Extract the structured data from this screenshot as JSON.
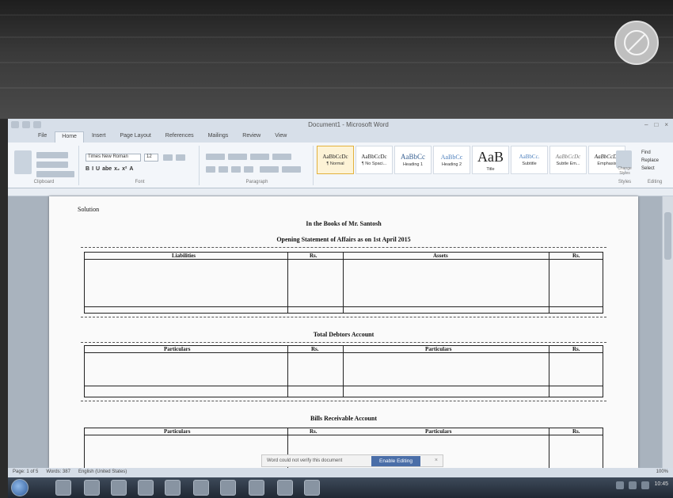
{
  "window": {
    "title": "Document1 - Microsoft Word",
    "controls": [
      "–",
      "□",
      "×"
    ]
  },
  "tabs": [
    "File",
    "Home",
    "Insert",
    "Page Layout",
    "References",
    "Mailings",
    "Review",
    "View"
  ],
  "ribbon": {
    "font_name": "Times New Roman",
    "font_size": "12",
    "format_buttons": [
      "B",
      "I",
      "U",
      "abe",
      "x₂",
      "x²",
      "A"
    ],
    "groups": [
      "Clipboard",
      "Font",
      "Paragraph",
      "Styles",
      "Editing"
    ],
    "styles": [
      {
        "sample": "AaBbCcDc",
        "name": "¶ Normal"
      },
      {
        "sample": "AaBbCcDc",
        "name": "¶ No Spaci..."
      },
      {
        "sample": "AaBbCc",
        "name": "Heading 1"
      },
      {
        "sample": "AaBbCc",
        "name": "Heading 2"
      },
      {
        "sample": "AaB",
        "name": "Title"
      },
      {
        "sample": "AaBbCc.",
        "name": "Subtitle"
      },
      {
        "sample": "AaBbCcDc",
        "name": "Subtle Em..."
      },
      {
        "sample": "AaBbCcDc",
        "name": "Emphasis"
      }
    ],
    "change_styles": "Change Styles",
    "editing": [
      "Find",
      "Replace",
      "Select"
    ]
  },
  "document": {
    "page_label": "Solution",
    "title": "In the Books of Mr. Santosh",
    "opening_statement": "Opening Statement of Affairs as on 1st April 2015",
    "sheet1": {
      "left_header": "Liabilities",
      "left_amount": "Rs.",
      "right_header": "Assets",
      "right_amount": "Rs."
    },
    "debtors_title": "Total Debtors Account",
    "sheet2": {
      "left_header": "Particulars",
      "left_amount": "Rs.",
      "right_header": "Particulars",
      "right_amount": "Rs."
    },
    "bills_title": "Bills Receivable Account",
    "sheet3": {
      "left_header": "Particulars",
      "left_amount": "Rs.",
      "right_header": "Particulars",
      "right_amount": "Rs."
    }
  },
  "notification": {
    "text": "Word could not verify this document",
    "button": "Enable Editing",
    "close": "×"
  },
  "statusbar": {
    "page": "Page: 1 of 5",
    "words": "Words: 387",
    "language": "English (United States)",
    "zoom": "100%"
  },
  "tray": {
    "time": "10:45"
  },
  "colors": {
    "accent": "#4a6ea8",
    "ribbon": "#f3f6fa",
    "page": "#fafafa"
  }
}
